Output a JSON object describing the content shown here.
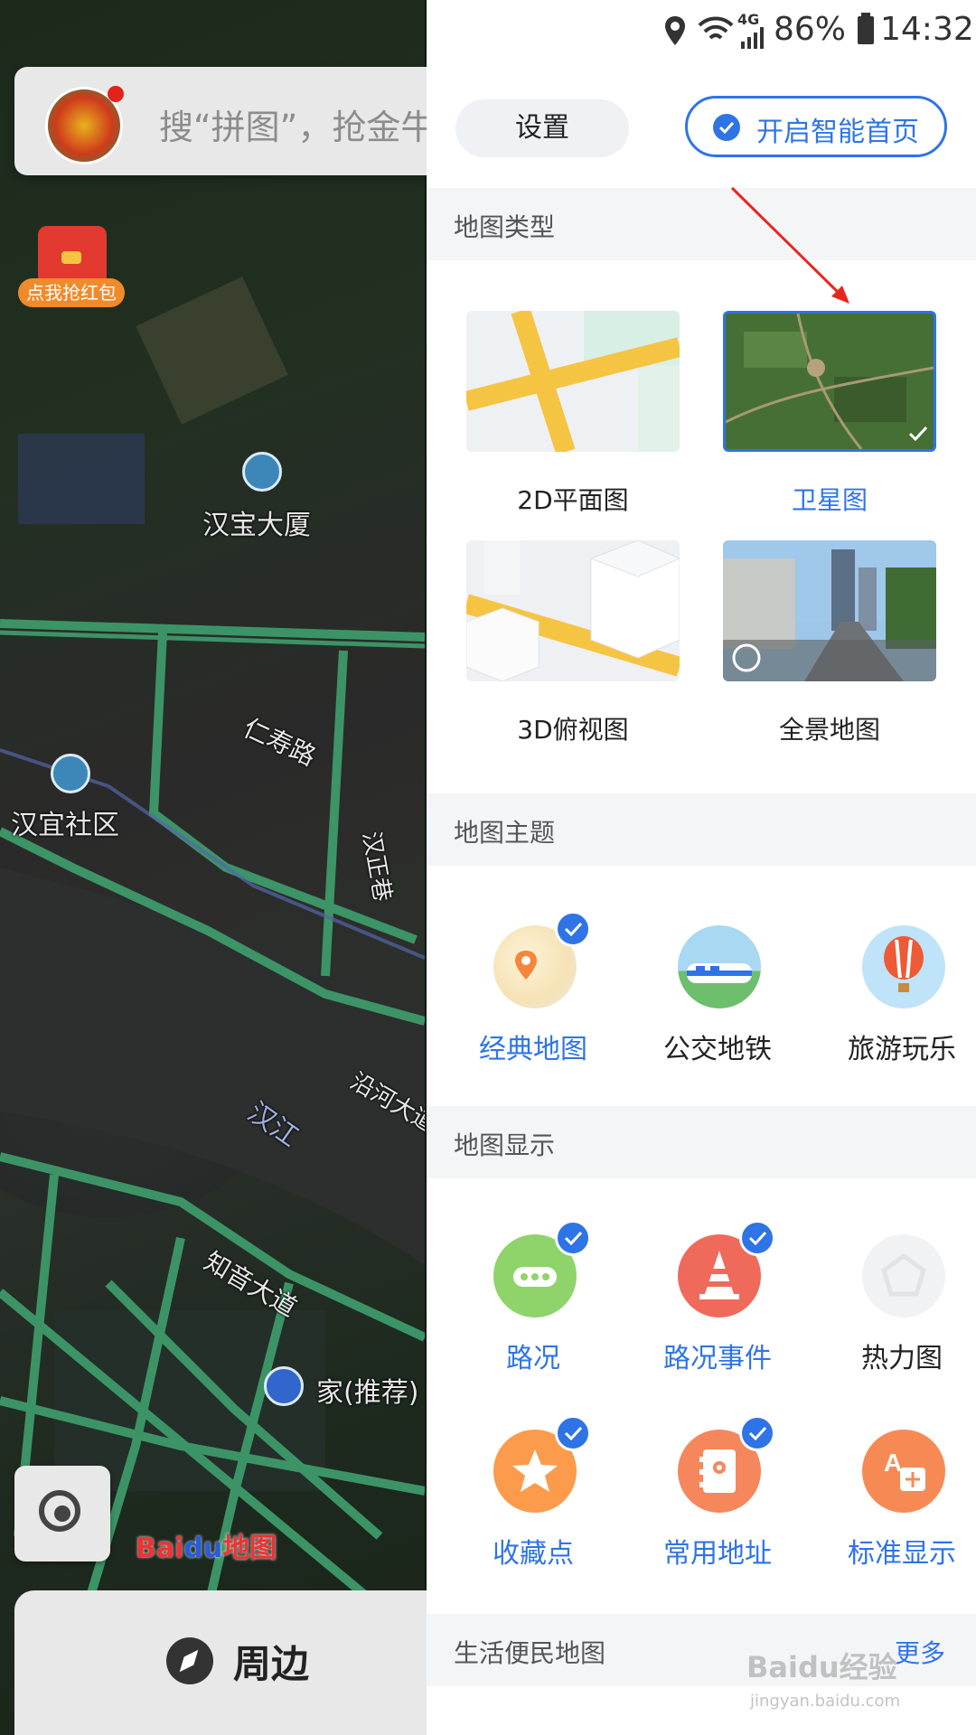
{
  "map": {
    "search_placeholder": "搜“拼图”，抢金牛",
    "red_packet_label": "点我抢红包",
    "labels": [
      "汉宝大厦",
      "仁寿路",
      "汉宜社区",
      "汉正巷",
      "沿河大道",
      "汉江",
      "知音大道",
      "家(推荐)"
    ],
    "baidu_logo": {
      "left": "Bai",
      "du": "du",
      "right": "地图"
    },
    "nearby_label": "周边",
    "locate_icon": "locate-icon"
  },
  "status_bar": {
    "network": "4G",
    "battery": "86%",
    "time": "14:32"
  },
  "drawer": {
    "settings_label": "设置",
    "smart_home_label": "开启智能首页",
    "map_type": {
      "title": "地图类型",
      "items": [
        {
          "label": "2D平面图",
          "selected": false
        },
        {
          "label": "卫星图",
          "selected": true
        },
        {
          "label": "3D俯视图",
          "selected": false
        },
        {
          "label": "全景地图",
          "selected": false
        }
      ]
    },
    "map_theme": {
      "title": "地图主题",
      "items": [
        {
          "label": "经典地图",
          "selected": true,
          "icon": "map-pin-icon"
        },
        {
          "label": "公交地铁",
          "selected": false,
          "icon": "train-icon"
        },
        {
          "label": "旅游玩乐",
          "selected": false,
          "icon": "balloon-icon"
        }
      ]
    },
    "map_display": {
      "title": "地图显示",
      "items": [
        {
          "label": "路况",
          "checked": true,
          "enabled": true,
          "icon": "traffic-icon"
        },
        {
          "label": "路况事件",
          "checked": true,
          "enabled": true,
          "icon": "cone-icon"
        },
        {
          "label": "热力图",
          "checked": false,
          "enabled": false,
          "icon": "heatmap-icon"
        },
        {
          "label": "收藏点",
          "checked": true,
          "enabled": true,
          "icon": "star-icon"
        },
        {
          "label": "常用地址",
          "checked": true,
          "enabled": true,
          "icon": "address-book-icon"
        },
        {
          "label": "标准显示",
          "checked": false,
          "enabled": true,
          "icon": "standard-label-icon"
        }
      ]
    },
    "life_map": {
      "title": "生活便民地图",
      "more_label": "更多"
    }
  },
  "watermark": {
    "main": "Baidu经验",
    "sub": "jingyan.baidu.com"
  },
  "colors": {
    "accent": "#2f74e7",
    "traffic_green": "#8fd36b",
    "cone_red": "#f06a5c",
    "star_orange": "#fb9b4b",
    "address_orange": "#f6875c",
    "annotation_arrow": "#e9261e"
  }
}
